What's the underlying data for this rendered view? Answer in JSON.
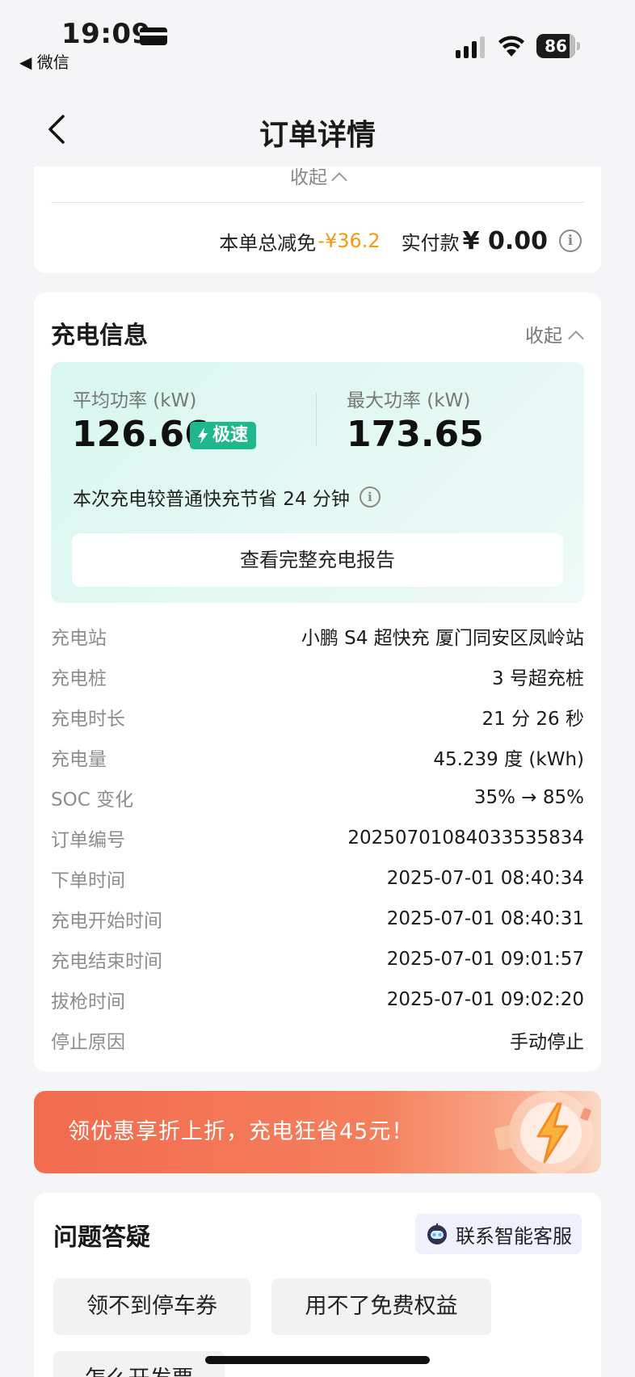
{
  "status_bar": {
    "time": "19:09",
    "back_app": "◀ 微信",
    "battery": "86",
    "battery_level": 0.86
  },
  "nav": {
    "title": "订单详情"
  },
  "summary": {
    "collapse_label": "收起",
    "discount_label": "本单总减免",
    "discount_value": "-¥36.2",
    "paid_label": "实付款",
    "paid_value": "¥ 0.00"
  },
  "charge_info": {
    "title": "充电信息",
    "collapse_label": "收起",
    "avg_power_label": "平均功率 (kW)",
    "avg_power_value": "126.66",
    "speed_badge": "极速",
    "max_power_label": "最大功率 (kW)",
    "max_power_value": "173.65",
    "saving_text": "本次充电较普通快充节省 24 分钟",
    "report_button": "查看完整充电报告",
    "details": [
      {
        "label": "充电站",
        "value": "小鹏 S4 超快充 厦门同安区凤岭站"
      },
      {
        "label": "充电桩",
        "value": "3 号超充桩"
      },
      {
        "label": "充电时长",
        "value": "21 分 26 秒"
      },
      {
        "label": "充电量",
        "value": "45.239 度 (kWh)"
      },
      {
        "label": "SOC 变化",
        "value": "35% → 85%"
      },
      {
        "label": "订单编号",
        "value": "20250701084033535834"
      },
      {
        "label": "下单时间",
        "value": "2025-07-01 08:40:34"
      },
      {
        "label": "充电开始时间",
        "value": "2025-07-01 08:40:31"
      },
      {
        "label": "充电结束时间",
        "value": "2025-07-01 09:01:57"
      },
      {
        "label": "拔枪时间",
        "value": "2025-07-01 09:02:20"
      },
      {
        "label": "停止原因",
        "value": "手动停止"
      }
    ]
  },
  "promo": {
    "text": "领优惠享折上折，充电狂省45元！"
  },
  "faq": {
    "title": "问题答疑",
    "service_button": "联系智能客服",
    "chips": [
      "领不到停车券",
      "用不了免费权益",
      "怎么开发票"
    ]
  },
  "colors": {
    "accent_green": "#1eb88c",
    "discount_orange": "#f29a12",
    "promo_orange": "#f26b4e"
  },
  "icons": [
    "card-icon",
    "signal-icon",
    "wifi-icon",
    "battery-icon",
    "back-arrow-icon",
    "chevron-up-icon",
    "info-icon",
    "bolt-icon",
    "lightning-promo-icon",
    "robot-icon"
  ]
}
